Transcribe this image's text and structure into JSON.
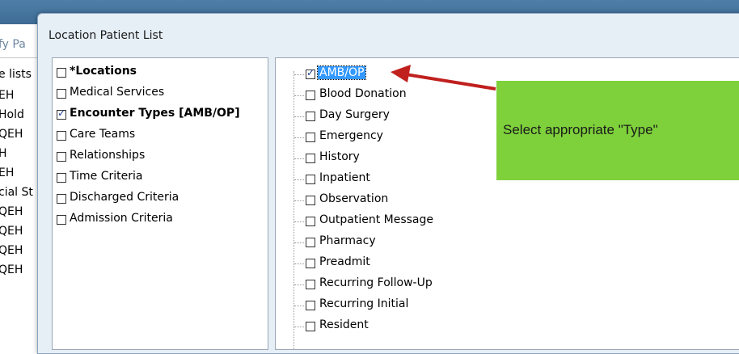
{
  "background": {
    "partial_text": "fy Pa",
    "list_header": "e lists",
    "items": [
      "EH",
      "Hold",
      "QEH",
      "H",
      "EH",
      "cial St",
      "QEH",
      "QEH",
      "QEH",
      "QEH"
    ]
  },
  "dialog": {
    "title": "Location Patient List"
  },
  "left_panel": {
    "items": [
      {
        "label": "*Locations",
        "checked": false,
        "bold": true
      },
      {
        "label": "Medical Services",
        "checked": false,
        "bold": false
      },
      {
        "label": "Encounter Types [AMB/OP]",
        "checked": true,
        "bold": true
      },
      {
        "label": "Care Teams",
        "checked": false,
        "bold": false
      },
      {
        "label": "Relationships",
        "checked": false,
        "bold": false
      },
      {
        "label": "Time Criteria",
        "checked": false,
        "bold": false
      },
      {
        "label": "Discharged Criteria",
        "checked": false,
        "bold": false
      },
      {
        "label": "Admission Criteria",
        "checked": false,
        "bold": false
      }
    ]
  },
  "right_panel": {
    "items": [
      {
        "label": "AMB/OP",
        "checked": true,
        "selected": true
      },
      {
        "label": "Blood Donation",
        "checked": false
      },
      {
        "label": "Day Surgery",
        "checked": false
      },
      {
        "label": "Emergency",
        "checked": false
      },
      {
        "label": "History",
        "checked": false
      },
      {
        "label": "Inpatient",
        "checked": false
      },
      {
        "label": "Observation",
        "checked": false
      },
      {
        "label": "Outpatient Message",
        "checked": false
      },
      {
        "label": "Pharmacy",
        "checked": false
      },
      {
        "label": "Preadmit",
        "checked": false
      },
      {
        "label": "Recurring Follow-Up",
        "checked": false
      },
      {
        "label": "Recurring Initial",
        "checked": false
      },
      {
        "label": "Resident",
        "checked": false
      }
    ]
  },
  "annotation": {
    "text": "Select  appropriate \"Type\"",
    "box_color": "#7ed13b",
    "arrow_color": "#c0201e"
  }
}
